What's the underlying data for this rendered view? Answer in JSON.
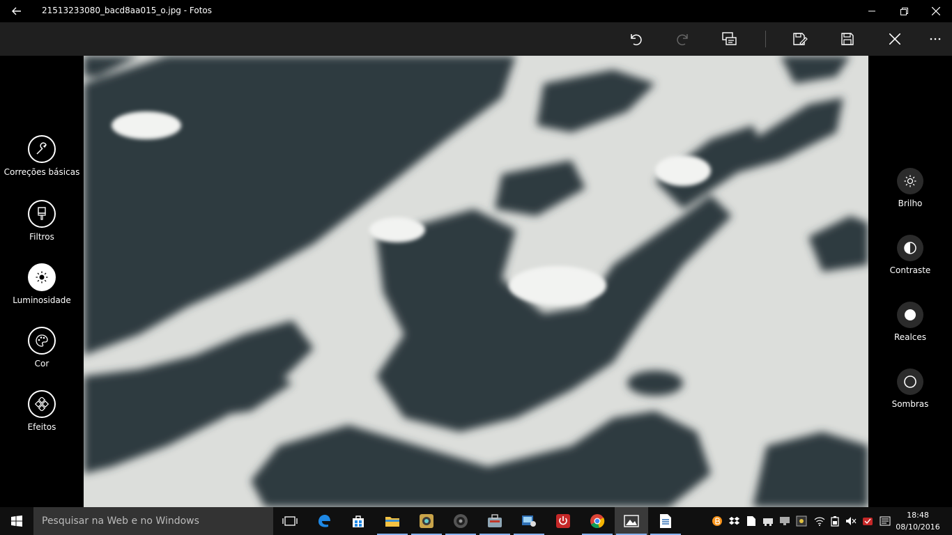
{
  "window": {
    "title": "21513233080_bacd8aa015_o.jpg - Fotos"
  },
  "left_tools": [
    {
      "label": "Correções básicas",
      "icon": "wrench-icon"
    },
    {
      "label": "Filtros",
      "icon": "brush-icon"
    },
    {
      "label": "Luminosidade",
      "icon": "sun-icon",
      "selected": true
    },
    {
      "label": "Cor",
      "icon": "palette-icon"
    },
    {
      "label": "Efeitos",
      "icon": "effects-icon"
    }
  ],
  "right_tools": [
    {
      "label": "Brilho",
      "icon": "brightness-icon"
    },
    {
      "label": "Contraste",
      "icon": "contrast-icon"
    },
    {
      "label": "Realces",
      "icon": "highlights-icon"
    },
    {
      "label": "Sombras",
      "icon": "shadows-icon"
    }
  ],
  "taskbar": {
    "search_placeholder": "Pesquisar na Web e no Windows",
    "time": "18:48",
    "date": "08/10/2016"
  },
  "colors": {
    "toolbar_bg": "#1f1f1f",
    "taskbar_bg": "#101010",
    "active_underline": "#8ab4f0"
  }
}
